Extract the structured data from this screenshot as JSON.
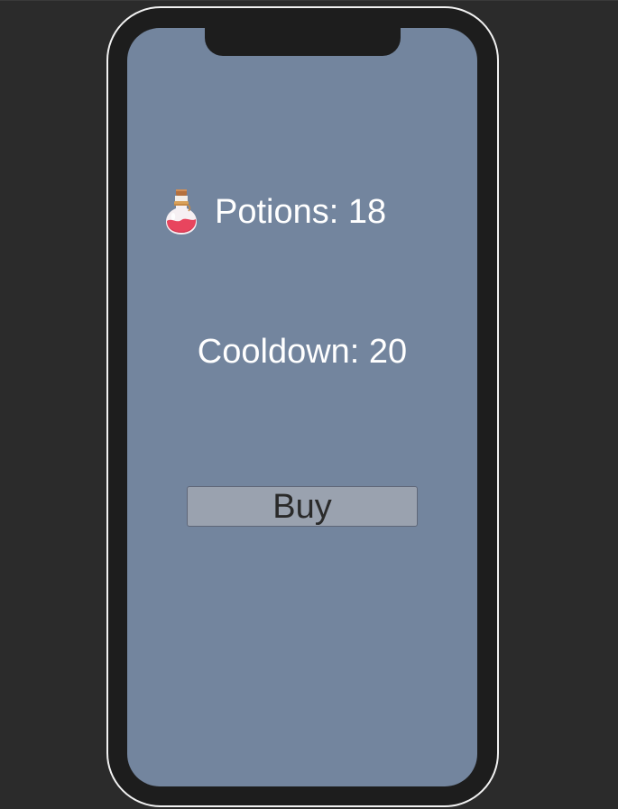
{
  "hud": {
    "potions_label": "Potions: 18",
    "cooldown_label": "Cooldown: 20"
  },
  "shop": {
    "buy_label": "Buy"
  },
  "icons": {
    "potion": "potion-bottle-icon"
  },
  "colors": {
    "screen_background": "#73859e",
    "device_frame": "#1d1d1d",
    "button_background": "#9aa2af",
    "text_primary": "#ffffff",
    "potion_liquid": "#e8455e"
  }
}
